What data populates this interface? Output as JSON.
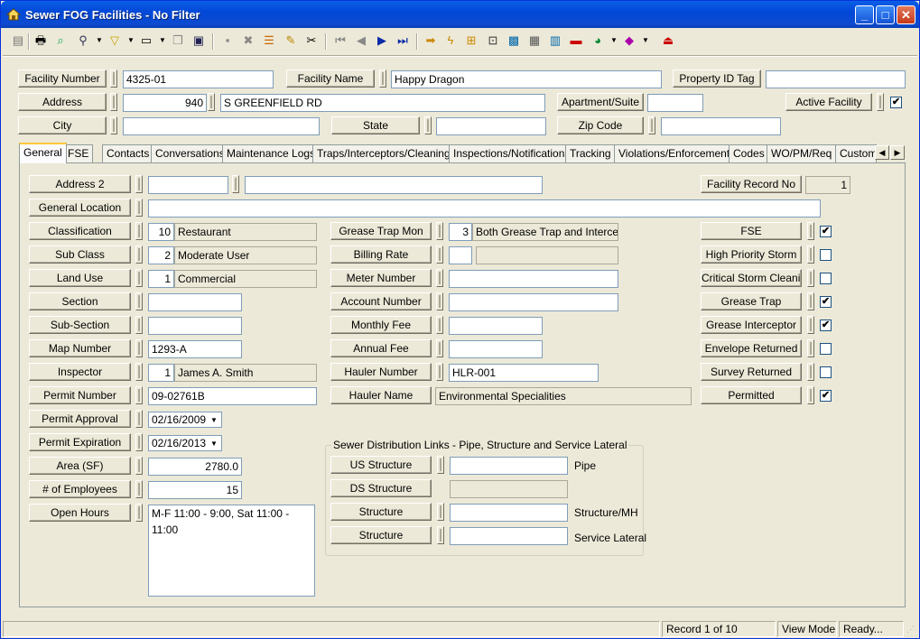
{
  "window": {
    "title": "Sewer FOG Facilities - No Filter"
  },
  "header": {
    "facility_number_label": "Facility Number",
    "facility_number": "4325-01",
    "facility_name_label": "Facility Name",
    "facility_name": "Happy Dragon",
    "property_id_label": "Property ID Tag",
    "property_id": "",
    "address_label": "Address",
    "address_number": "940",
    "address_street": "S GREENFIELD RD",
    "apartment_label": "Apartment/Suite",
    "apartment": "",
    "active_label": "Active Facility",
    "active_checked": "✔",
    "city_label": "City",
    "city": "",
    "state_label": "State",
    "state": "",
    "zip_label": "Zip Code",
    "zip": ""
  },
  "tabs": [
    "General",
    "FSE",
    "Contacts",
    "Conversations",
    "Maintenance Logs",
    "Traps/Interceptors/Cleanings",
    "Inspections/Notifications",
    "Tracking",
    "Violations/Enforcements",
    "Codes",
    "WO/PM/Req",
    "Custom"
  ],
  "general": {
    "address2_label": "Address 2",
    "address2_a": "",
    "address2_b": "",
    "facility_record_label": "Facility Record No",
    "facility_record": "1",
    "general_location_label": "General Location",
    "general_location": "",
    "classification_label": "Classification",
    "classification_code": "10",
    "classification": "Restaurant",
    "subclass_label": "Sub Class",
    "subclass_code": "2",
    "subclass": "Moderate User",
    "landuse_label": "Land Use",
    "landuse_code": "1",
    "landuse": "Commercial",
    "section_label": "Section",
    "section": "",
    "subsection_label": "Sub-Section",
    "subsection": "",
    "map_label": "Map Number",
    "map": "1293-A",
    "inspector_label": "Inspector",
    "inspector_code": "1",
    "inspector": "James A. Smith",
    "permit_number_label": "Permit Number",
    "permit_number": "09-02761B",
    "permit_approval_label": "Permit Approval",
    "permit_approval": "02/16/2009",
    "permit_expiration_label": "Permit Expiration",
    "permit_expiration": "02/16/2013",
    "area_label": "Area (SF)",
    "area": "2780.0",
    "employees_label": "# of Employees",
    "employees": "15",
    "hours_label": "Open Hours",
    "hours": "M-F 11:00 - 9:00, Sat 11:00 - 11:00",
    "grease_mon_label": "Grease Trap Mon",
    "grease_mon_code": "3",
    "grease_mon": "Both Grease Trap and Intercept",
    "billing_label": "Billing Rate",
    "billing_code": "",
    "billing": "",
    "meter_label": "Meter Number",
    "meter": "",
    "account_label": "Account Number",
    "account": "",
    "monthly_label": "Monthly Fee",
    "monthly": "",
    "annual_label": "Annual Fee",
    "annual": "",
    "hauler_number_label": "Hauler Number",
    "hauler_number": "HLR-001",
    "hauler_name_label": "Hauler Name",
    "hauler_name": "Environmental Specialities",
    "flags": [
      {
        "label": "FSE",
        "mark": "✔"
      },
      {
        "label": "High Priority Storm",
        "mark": ""
      },
      {
        "label": "Critical Storm Cleaning",
        "mark": ""
      },
      {
        "label": "Grease Trap",
        "mark": "✔"
      },
      {
        "label": "Grease Interceptor",
        "mark": "✔"
      },
      {
        "label": "Envelope Returned",
        "mark": ""
      },
      {
        "label": "Survey Returned",
        "mark": ""
      },
      {
        "label": "Permitted",
        "mark": "✔"
      }
    ]
  },
  "sewer_links": {
    "title": "Sewer Distribution Links - Pipe, Structure and Service Lateral",
    "us_label": "US Structure",
    "us_value": "",
    "us_suffix": "Pipe",
    "ds_label": "DS Structure",
    "ds_value": "",
    "structure_label": "Structure",
    "structure_value": "",
    "structure_suffix": "Structure/MH",
    "structure2_label": "Structure",
    "structure2_value": "",
    "structure2_suffix": "Service Lateral"
  },
  "status": {
    "record": "Record 1 of 10",
    "mode": "View Mode",
    "state": "Ready..."
  }
}
